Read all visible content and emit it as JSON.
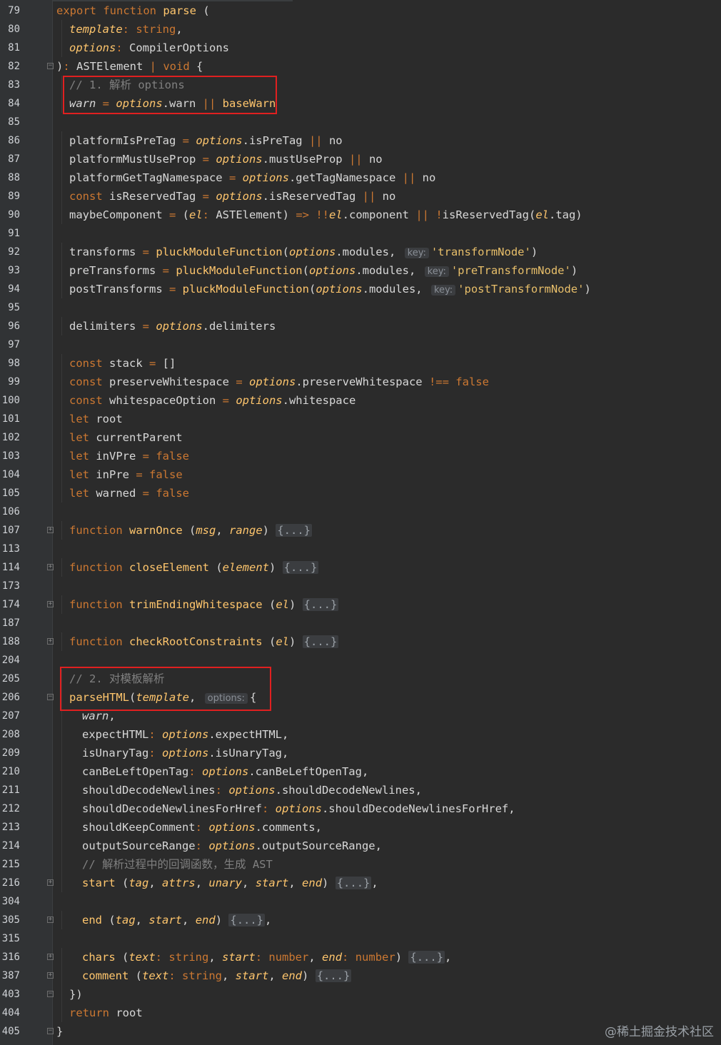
{
  "lines": [
    {
      "n": "79",
      "indent": 0,
      "fold": "",
      "segs": [
        [
          "kw",
          "export function "
        ],
        [
          "fn",
          "parse"
        ],
        [
          "plain",
          " ("
        ]
      ]
    },
    {
      "n": "80",
      "indent": 1,
      "fold": "",
      "segs": [
        [
          "param",
          "template"
        ],
        [
          "op",
          ": "
        ],
        [
          "kw",
          "string"
        ],
        [
          "plain",
          ","
        ]
      ]
    },
    {
      "n": "81",
      "indent": 1,
      "fold": "",
      "segs": [
        [
          "param",
          "options"
        ],
        [
          "op",
          ": "
        ],
        [
          "plain",
          "CompilerOptions"
        ]
      ]
    },
    {
      "n": "82",
      "indent": 0,
      "fold": "fold-end",
      "segs": [
        [
          "plain",
          ")"
        ],
        [
          "op",
          ": "
        ],
        [
          "plain",
          "ASTElement "
        ],
        [
          "op",
          "| "
        ],
        [
          "kw",
          "void"
        ],
        [
          "plain",
          " {"
        ]
      ]
    },
    {
      "n": "83",
      "indent": 1,
      "fold": "",
      "segs": [
        [
          "cmt",
          "// 1. 解析 options"
        ]
      ]
    },
    {
      "n": "84",
      "indent": 1,
      "fold": "",
      "segs": [
        [
          "italic-var",
          "warn"
        ],
        [
          "op",
          " = "
        ],
        [
          "param",
          "options"
        ],
        [
          "plain",
          ".warn "
        ],
        [
          "op",
          "|| "
        ],
        [
          "fn",
          "baseWarn"
        ]
      ]
    },
    {
      "n": "85",
      "indent": 0,
      "fold": "",
      "segs": []
    },
    {
      "n": "86",
      "indent": 1,
      "fold": "",
      "segs": [
        [
          "plain",
          "platformIsPreTag "
        ],
        [
          "op",
          "= "
        ],
        [
          "param",
          "options"
        ],
        [
          "plain",
          ".isPreTag "
        ],
        [
          "op",
          "|| "
        ],
        [
          "plain",
          "no"
        ]
      ]
    },
    {
      "n": "87",
      "indent": 1,
      "fold": "",
      "segs": [
        [
          "plain",
          "platformMustUseProp "
        ],
        [
          "op",
          "= "
        ],
        [
          "param",
          "options"
        ],
        [
          "plain",
          ".mustUseProp "
        ],
        [
          "op",
          "|| "
        ],
        [
          "plain",
          "no"
        ]
      ]
    },
    {
      "n": "88",
      "indent": 1,
      "fold": "",
      "segs": [
        [
          "plain",
          "platformGetTagNamespace "
        ],
        [
          "op",
          "= "
        ],
        [
          "param",
          "options"
        ],
        [
          "plain",
          ".getTagNamespace "
        ],
        [
          "op",
          "|| "
        ],
        [
          "plain",
          "no"
        ]
      ]
    },
    {
      "n": "89",
      "indent": 1,
      "fold": "",
      "segs": [
        [
          "kw",
          "const "
        ],
        [
          "plain",
          "isReservedTag "
        ],
        [
          "op",
          "= "
        ],
        [
          "param",
          "options"
        ],
        [
          "plain",
          ".isReservedTag "
        ],
        [
          "op",
          "|| "
        ],
        [
          "plain",
          "no"
        ]
      ]
    },
    {
      "n": "90",
      "indent": 1,
      "fold": "",
      "segs": [
        [
          "plain",
          "maybeComponent "
        ],
        [
          "op",
          "= "
        ],
        [
          "plain",
          "("
        ],
        [
          "param",
          "el"
        ],
        [
          "op",
          ": "
        ],
        [
          "plain",
          "ASTElement) "
        ],
        [
          "op",
          "=> !!"
        ],
        [
          "param",
          "el"
        ],
        [
          "plain",
          ".component "
        ],
        [
          "op",
          "|| !"
        ],
        [
          "plain",
          "isReservedTag("
        ],
        [
          "param",
          "el"
        ],
        [
          "plain",
          ".tag)"
        ]
      ]
    },
    {
      "n": "91",
      "indent": 0,
      "fold": "",
      "segs": []
    },
    {
      "n": "92",
      "indent": 1,
      "fold": "",
      "segs": [
        [
          "plain",
          "transforms "
        ],
        [
          "op",
          "= "
        ],
        [
          "fn",
          "pluckModuleFunction"
        ],
        [
          "plain",
          "("
        ],
        [
          "param",
          "options"
        ],
        [
          "plain",
          ".modules, "
        ],
        [
          "hint",
          "key:"
        ],
        [
          "str",
          "'transformNode'"
        ],
        [
          "plain",
          ")"
        ]
      ]
    },
    {
      "n": "93",
      "indent": 1,
      "fold": "",
      "segs": [
        [
          "plain",
          "preTransforms "
        ],
        [
          "op",
          "= "
        ],
        [
          "fn",
          "pluckModuleFunction"
        ],
        [
          "plain",
          "("
        ],
        [
          "param",
          "options"
        ],
        [
          "plain",
          ".modules, "
        ],
        [
          "hint",
          "key:"
        ],
        [
          "str",
          "'preTransformNode'"
        ],
        [
          "plain",
          ")"
        ]
      ]
    },
    {
      "n": "94",
      "indent": 1,
      "fold": "",
      "segs": [
        [
          "plain",
          "postTransforms "
        ],
        [
          "op",
          "= "
        ],
        [
          "fn",
          "pluckModuleFunction"
        ],
        [
          "plain",
          "("
        ],
        [
          "param",
          "options"
        ],
        [
          "plain",
          ".modules, "
        ],
        [
          "hint",
          "key:"
        ],
        [
          "str",
          "'postTransformNode'"
        ],
        [
          "plain",
          ")"
        ]
      ]
    },
    {
      "n": "95",
      "indent": 0,
      "fold": "",
      "segs": []
    },
    {
      "n": "96",
      "indent": 1,
      "fold": "",
      "segs": [
        [
          "plain",
          "delimiters "
        ],
        [
          "op",
          "= "
        ],
        [
          "param",
          "options"
        ],
        [
          "plain",
          ".delimiters"
        ]
      ]
    },
    {
      "n": "97",
      "indent": 0,
      "fold": "",
      "segs": []
    },
    {
      "n": "98",
      "indent": 1,
      "fold": "",
      "segs": [
        [
          "kw",
          "const "
        ],
        [
          "plain",
          "stack "
        ],
        [
          "op",
          "= "
        ],
        [
          "plain",
          "[]"
        ]
      ]
    },
    {
      "n": "99",
      "indent": 1,
      "fold": "",
      "segs": [
        [
          "kw",
          "const "
        ],
        [
          "plain",
          "preserveWhitespace "
        ],
        [
          "op",
          "= "
        ],
        [
          "param",
          "options"
        ],
        [
          "plain",
          ".preserveWhitespace "
        ],
        [
          "op",
          "!== "
        ],
        [
          "kw",
          "false"
        ]
      ]
    },
    {
      "n": "100",
      "indent": 1,
      "fold": "",
      "segs": [
        [
          "kw",
          "const "
        ],
        [
          "plain",
          "whitespaceOption "
        ],
        [
          "op",
          "= "
        ],
        [
          "param",
          "options"
        ],
        [
          "plain",
          ".whitespace"
        ]
      ]
    },
    {
      "n": "101",
      "indent": 1,
      "fold": "",
      "segs": [
        [
          "kw",
          "let "
        ],
        [
          "plain",
          "root"
        ]
      ]
    },
    {
      "n": "102",
      "indent": 1,
      "fold": "",
      "segs": [
        [
          "kw",
          "let "
        ],
        [
          "plain",
          "currentParent"
        ]
      ]
    },
    {
      "n": "103",
      "indent": 1,
      "fold": "",
      "segs": [
        [
          "kw",
          "let "
        ],
        [
          "plain",
          "inVPre "
        ],
        [
          "op",
          "= "
        ],
        [
          "kw",
          "false"
        ]
      ]
    },
    {
      "n": "104",
      "indent": 1,
      "fold": "",
      "segs": [
        [
          "kw",
          "let "
        ],
        [
          "plain",
          "inPre "
        ],
        [
          "op",
          "= "
        ],
        [
          "kw",
          "false"
        ]
      ]
    },
    {
      "n": "105",
      "indent": 1,
      "fold": "",
      "segs": [
        [
          "kw",
          "let "
        ],
        [
          "plain",
          "warned "
        ],
        [
          "op",
          "= "
        ],
        [
          "kw",
          "false"
        ]
      ]
    },
    {
      "n": "106",
      "indent": 0,
      "fold": "",
      "segs": []
    },
    {
      "n": "107",
      "indent": 1,
      "fold": "plus",
      "segs": [
        [
          "kw",
          "function "
        ],
        [
          "fn",
          "warnOnce"
        ],
        [
          "plain",
          " ("
        ],
        [
          "param",
          "msg"
        ],
        [
          "plain",
          ", "
        ],
        [
          "param",
          "range"
        ],
        [
          "plain",
          ") "
        ],
        [
          "collapsed",
          "{...}"
        ]
      ]
    },
    {
      "n": "113",
      "indent": 0,
      "fold": "",
      "segs": []
    },
    {
      "n": "114",
      "indent": 1,
      "fold": "plus",
      "segs": [
        [
          "kw",
          "function "
        ],
        [
          "fn",
          "closeElement"
        ],
        [
          "plain",
          " ("
        ],
        [
          "param",
          "element"
        ],
        [
          "plain",
          ") "
        ],
        [
          "collapsed",
          "{...}"
        ]
      ]
    },
    {
      "n": "173",
      "indent": 0,
      "fold": "",
      "segs": []
    },
    {
      "n": "174",
      "indent": 1,
      "fold": "plus",
      "segs": [
        [
          "kw",
          "function "
        ],
        [
          "fn",
          "trimEndingWhitespace"
        ],
        [
          "plain",
          " ("
        ],
        [
          "param",
          "el"
        ],
        [
          "plain",
          ") "
        ],
        [
          "collapsed",
          "{...}"
        ]
      ]
    },
    {
      "n": "187",
      "indent": 0,
      "fold": "",
      "segs": []
    },
    {
      "n": "188",
      "indent": 1,
      "fold": "plus",
      "segs": [
        [
          "kw",
          "function "
        ],
        [
          "fn",
          "checkRootConstraints"
        ],
        [
          "plain",
          " ("
        ],
        [
          "param",
          "el"
        ],
        [
          "plain",
          ") "
        ],
        [
          "collapsed",
          "{...}"
        ]
      ]
    },
    {
      "n": "204",
      "indent": 0,
      "fold": "",
      "segs": []
    },
    {
      "n": "205",
      "indent": 1,
      "fold": "",
      "segs": [
        [
          "cmt",
          "// 2. 对模板解析"
        ]
      ]
    },
    {
      "n": "206",
      "indent": 1,
      "fold": "fold-start",
      "segs": [
        [
          "fn",
          "parseHTML"
        ],
        [
          "plain",
          "("
        ],
        [
          "param",
          "template"
        ],
        [
          "plain",
          ", "
        ],
        [
          "hint",
          "options:"
        ],
        [
          "plain",
          "{"
        ]
      ]
    },
    {
      "n": "207",
      "indent": 2,
      "fold": "",
      "segs": [
        [
          "italic-var",
          "warn"
        ],
        [
          "plain",
          ","
        ]
      ]
    },
    {
      "n": "208",
      "indent": 2,
      "fold": "",
      "segs": [
        [
          "plain",
          "expectHTML"
        ],
        [
          "op",
          ": "
        ],
        [
          "param",
          "options"
        ],
        [
          "plain",
          ".expectHTML,"
        ]
      ]
    },
    {
      "n": "209",
      "indent": 2,
      "fold": "",
      "segs": [
        [
          "plain",
          "isUnaryTag"
        ],
        [
          "op",
          ": "
        ],
        [
          "param",
          "options"
        ],
        [
          "plain",
          ".isUnaryTag,"
        ]
      ]
    },
    {
      "n": "210",
      "indent": 2,
      "fold": "",
      "segs": [
        [
          "plain",
          "canBeLeftOpenTag"
        ],
        [
          "op",
          ": "
        ],
        [
          "param",
          "options"
        ],
        [
          "plain",
          ".canBeLeftOpenTag,"
        ]
      ]
    },
    {
      "n": "211",
      "indent": 2,
      "fold": "",
      "segs": [
        [
          "plain",
          "shouldDecodeNewlines"
        ],
        [
          "op",
          ": "
        ],
        [
          "param",
          "options"
        ],
        [
          "plain",
          ".shouldDecodeNewlines,"
        ]
      ]
    },
    {
      "n": "212",
      "indent": 2,
      "fold": "",
      "segs": [
        [
          "plain",
          "shouldDecodeNewlinesForHref"
        ],
        [
          "op",
          ": "
        ],
        [
          "param",
          "options"
        ],
        [
          "plain",
          ".shouldDecodeNewlinesForHref,"
        ]
      ]
    },
    {
      "n": "213",
      "indent": 2,
      "fold": "",
      "segs": [
        [
          "plain",
          "shouldKeepComment"
        ],
        [
          "op",
          ": "
        ],
        [
          "param",
          "options"
        ],
        [
          "plain",
          ".comments,"
        ]
      ]
    },
    {
      "n": "214",
      "indent": 2,
      "fold": "",
      "segs": [
        [
          "plain",
          "outputSourceRange"
        ],
        [
          "op",
          ": "
        ],
        [
          "param",
          "options"
        ],
        [
          "plain",
          ".outputSourceRange,"
        ]
      ]
    },
    {
      "n": "215",
      "indent": 2,
      "fold": "",
      "segs": [
        [
          "cmt",
          "// 解析过程中的回调函数，生成 AST"
        ]
      ]
    },
    {
      "n": "216",
      "indent": 2,
      "fold": "plus",
      "segs": [
        [
          "fn",
          "start"
        ],
        [
          "plain",
          " ("
        ],
        [
          "param",
          "tag"
        ],
        [
          "plain",
          ", "
        ],
        [
          "param",
          "attrs"
        ],
        [
          "plain",
          ", "
        ],
        [
          "param",
          "unary"
        ],
        [
          "plain",
          ", "
        ],
        [
          "param",
          "start"
        ],
        [
          "plain",
          ", "
        ],
        [
          "param",
          "end"
        ],
        [
          "plain",
          ") "
        ],
        [
          "collapsed",
          "{...}"
        ],
        [
          "plain",
          ","
        ]
      ]
    },
    {
      "n": "304",
      "indent": 0,
      "fold": "",
      "segs": []
    },
    {
      "n": "305",
      "indent": 2,
      "fold": "plus",
      "segs": [
        [
          "fn",
          "end"
        ],
        [
          "plain",
          " ("
        ],
        [
          "param",
          "tag"
        ],
        [
          "plain",
          ", "
        ],
        [
          "param",
          "start"
        ],
        [
          "plain",
          ", "
        ],
        [
          "param",
          "end"
        ],
        [
          "plain",
          ") "
        ],
        [
          "collapsed",
          "{...}"
        ],
        [
          "plain",
          ","
        ]
      ]
    },
    {
      "n": "315",
      "indent": 0,
      "fold": "",
      "segs": []
    },
    {
      "n": "316",
      "indent": 2,
      "fold": "plus",
      "segs": [
        [
          "fn",
          "chars"
        ],
        [
          "plain",
          " ("
        ],
        [
          "param",
          "text"
        ],
        [
          "op",
          ": "
        ],
        [
          "kw",
          "string"
        ],
        [
          "plain",
          ", "
        ],
        [
          "param",
          "start"
        ],
        [
          "op",
          ": "
        ],
        [
          "kw",
          "number"
        ],
        [
          "plain",
          ", "
        ],
        [
          "param",
          "end"
        ],
        [
          "op",
          ": "
        ],
        [
          "kw",
          "number"
        ],
        [
          "plain",
          ") "
        ],
        [
          "collapsed",
          "{...}"
        ],
        [
          "plain",
          ","
        ]
      ]
    },
    {
      "n": "387",
      "indent": 2,
      "fold": "plus",
      "segs": [
        [
          "fn",
          "comment"
        ],
        [
          "plain",
          " ("
        ],
        [
          "param",
          "text"
        ],
        [
          "op",
          ": "
        ],
        [
          "kw",
          "string"
        ],
        [
          "plain",
          ", "
        ],
        [
          "param",
          "start"
        ],
        [
          "plain",
          ", "
        ],
        [
          "param",
          "end"
        ],
        [
          "plain",
          ") "
        ],
        [
          "collapsed",
          "{...}"
        ]
      ]
    },
    {
      "n": "403",
      "indent": 1,
      "fold": "fold-end",
      "segs": [
        [
          "plain",
          "})"
        ]
      ]
    },
    {
      "n": "404",
      "indent": 1,
      "fold": "",
      "segs": [
        [
          "kw",
          "return "
        ],
        [
          "plain",
          "root"
        ]
      ]
    },
    {
      "n": "405",
      "indent": 0,
      "fold": "fold-end",
      "segs": [
        [
          "plain",
          "}"
        ]
      ]
    }
  ],
  "watermark": "@稀土掘金技术社区",
  "colors": {
    "background": "#2b2b2b",
    "keyword": "#cc7832",
    "function": "#ffc66d",
    "comment": "#808080",
    "highlight_box": "#e02020"
  }
}
